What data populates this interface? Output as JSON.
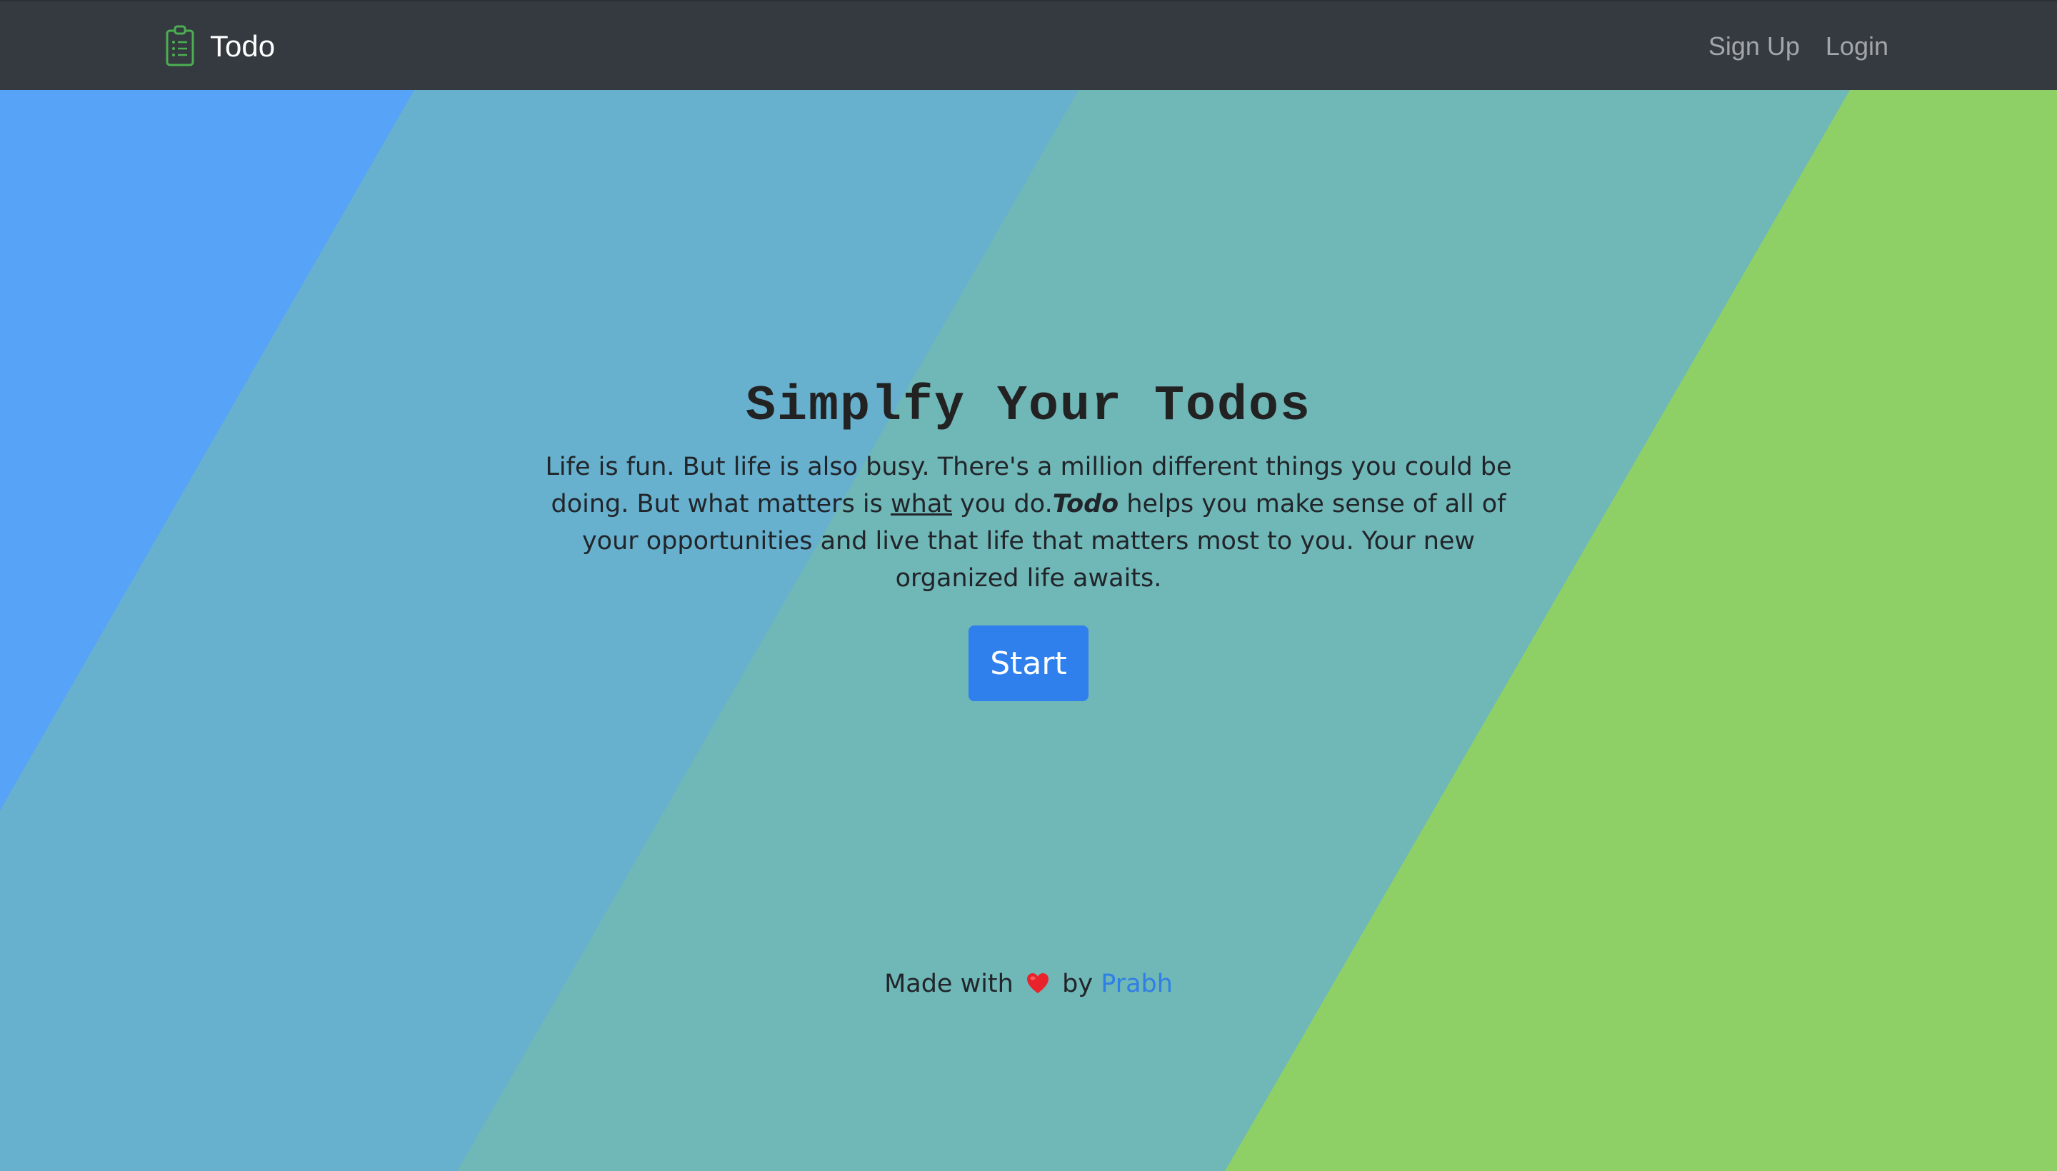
{
  "navbar": {
    "brand": "Todo",
    "brand_icon": "clipboard-list-icon",
    "links": [
      "Sign Up",
      "Login"
    ]
  },
  "hero": {
    "title": "Simplfy Your Todos",
    "text_part1": "Life is fun. But life is also busy. There's a million different things you could be doing. But what matters is ",
    "text_underlined": "what",
    "text_part2": " you do.",
    "text_brand": "Todo",
    "text_part3": " helps you make sense of all of your opportunities and live that life that matters most to you. Your new organized life awaits.",
    "button_label": "Start"
  },
  "footer": {
    "made_with": "Made with",
    "heart_icon": "heart-icon",
    "by": "by",
    "author": "Prabh"
  },
  "colors": {
    "navbar_bg": "#343a40",
    "bg_blue": "#56a3f8",
    "bg_lightblue": "#67b1cf",
    "bg_teal": "#70b7b8",
    "bg_green": "#8fd066",
    "button": "#2f80ed",
    "link": "#2f7fe6",
    "logo_green": "#4caf50"
  }
}
